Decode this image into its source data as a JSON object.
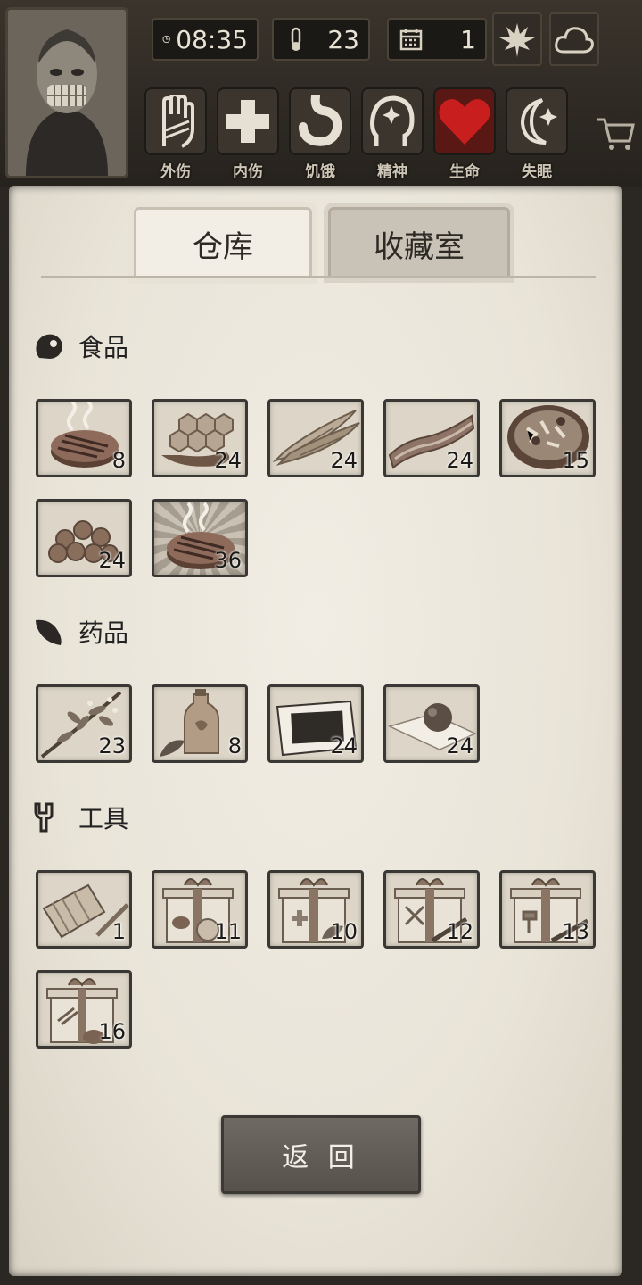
{
  "hud": {
    "time": "08:35",
    "temperature": "23",
    "day": "1",
    "weather_icons": [
      "leaf-icon",
      "cloud-icon"
    ],
    "statuses": [
      {
        "label": "外伤",
        "icon": "hand-icon"
      },
      {
        "label": "内伤",
        "icon": "cross-icon"
      },
      {
        "label": "饥饿",
        "icon": "stomach-icon"
      },
      {
        "label": "精神",
        "icon": "head-icon"
      },
      {
        "label": "生命",
        "icon": "heart-icon"
      },
      {
        "label": "失眠",
        "icon": "moon-icon"
      }
    ]
  },
  "tabs": {
    "warehouse": "仓库",
    "collection": "收藏室",
    "active": "warehouse"
  },
  "sections": {
    "food": {
      "title": "食品",
      "items": [
        {
          "name": "grilled-steak",
          "count": "8"
        },
        {
          "name": "honeycomb",
          "count": "24"
        },
        {
          "name": "dried-fish",
          "count": "24"
        },
        {
          "name": "bacon",
          "count": "24"
        },
        {
          "name": "stew-bowl",
          "count": "15"
        },
        {
          "name": "potatoes",
          "count": "24"
        },
        {
          "name": "grilled-steak-rare",
          "count": "36"
        }
      ]
    },
    "medicine": {
      "title": "药品",
      "items": [
        {
          "name": "herbs",
          "count": "23"
        },
        {
          "name": "medicine-bottle",
          "count": "8"
        },
        {
          "name": "plaster",
          "count": "24"
        },
        {
          "name": "pill",
          "count": "24"
        }
      ]
    },
    "tools": {
      "title": "工具",
      "items": [
        {
          "name": "flashlight",
          "count": "1"
        },
        {
          "name": "food-gift-box",
          "count": "11"
        },
        {
          "name": "medical-gift-box",
          "count": "10"
        },
        {
          "name": "weapon-gift-box",
          "count": "12"
        },
        {
          "name": "tool-gift-box",
          "count": "13"
        },
        {
          "name": "material-gift-box",
          "count": "16"
        }
      ]
    }
  },
  "back_button": "返 回",
  "colors": {
    "accent_heart": "#c81e1e",
    "paper": "#ece8de",
    "button": "#625e57"
  }
}
